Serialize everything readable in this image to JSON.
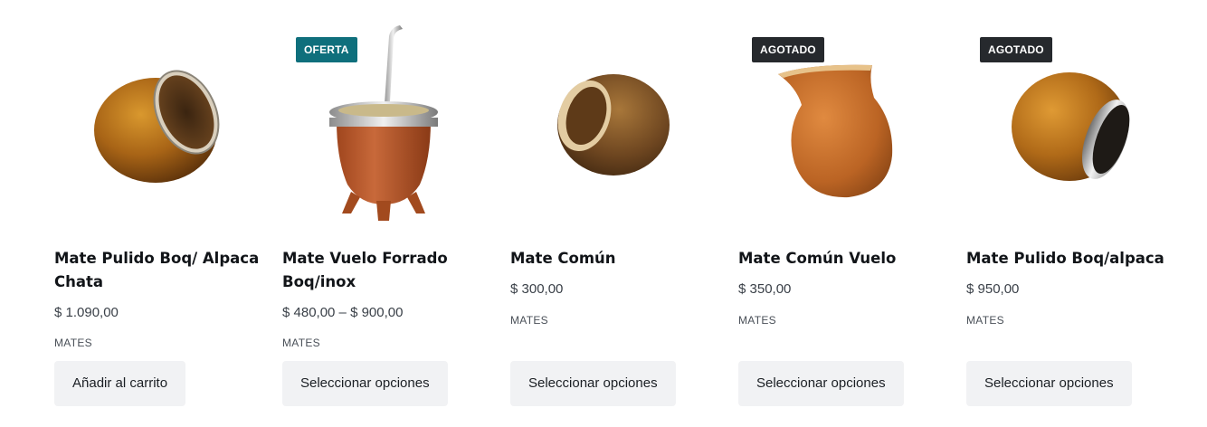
{
  "products": [
    {
      "title": "Mate Pulido Boq/ Alpaca Chata",
      "price": "$ 1.090,00",
      "category": "MATES",
      "button": "Añadir al carrito",
      "badge": ""
    },
    {
      "title": "Mate Vuelo Forrado Boq/inox",
      "price": "$ 480,00 – $ 900,00",
      "category": "MATES",
      "button": "Seleccionar opciones",
      "badge": "OFERTA"
    },
    {
      "title": "Mate Común",
      "price": "$ 300,00",
      "category": "MATES",
      "button": "Seleccionar opciones",
      "badge": ""
    },
    {
      "title": "Mate Común Vuelo",
      "price": "$ 350,00",
      "category": "MATES",
      "button": "Seleccionar opciones",
      "badge": "AGOTADO"
    },
    {
      "title": "Mate Pulido Boq/alpaca",
      "price": "$ 950,00",
      "category": "MATES",
      "button": "Seleccionar opciones",
      "badge": "AGOTADO"
    }
  ],
  "colors": {
    "sale_badge": "#0f6f7c",
    "soldout_badge": "#26292d",
    "button_bg": "#f1f2f4"
  }
}
